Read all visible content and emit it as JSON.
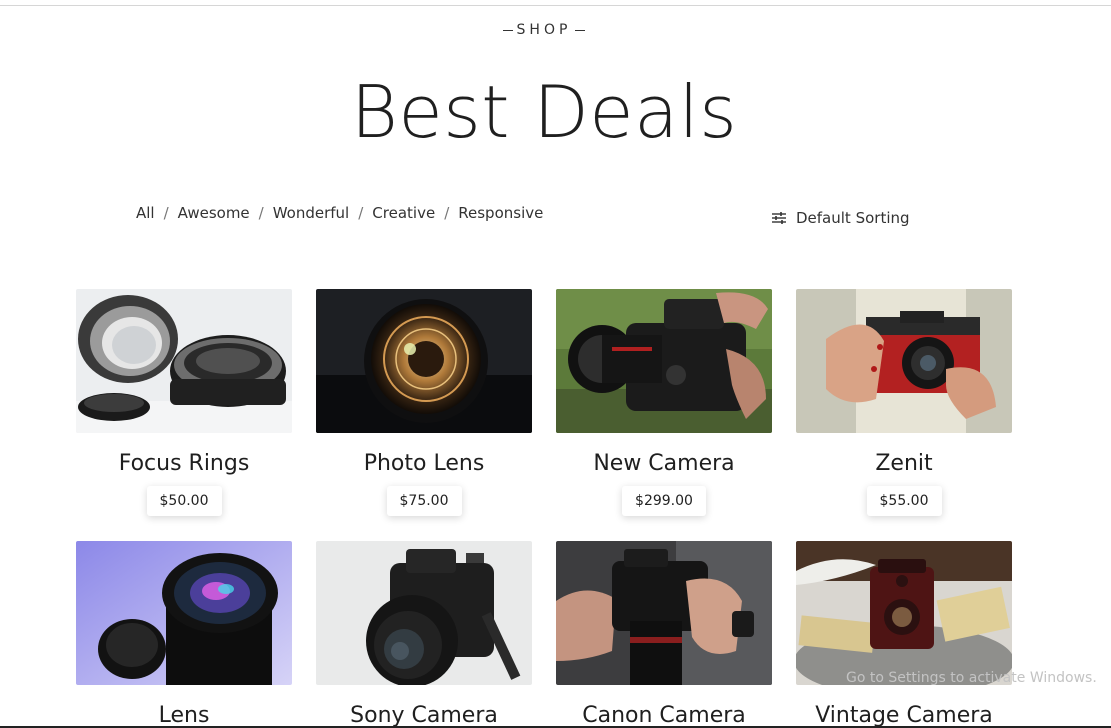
{
  "header": {
    "kicker": "SHOP",
    "title": "Best Deals"
  },
  "filters": [
    {
      "label": "All"
    },
    {
      "label": "Awesome"
    },
    {
      "label": "Wonderful"
    },
    {
      "label": "Creative"
    },
    {
      "label": "Responsive"
    }
  ],
  "filter_separator": "/",
  "sorting": {
    "label": "Default Sorting",
    "icon": "sliders-icon"
  },
  "products": [
    {
      "name": "Focus Rings",
      "price": "$50.00"
    },
    {
      "name": "Photo Lens",
      "price": "$75.00"
    },
    {
      "name": "New Camera",
      "price": "$299.00"
    },
    {
      "name": "Zenit",
      "price": "$55.00"
    },
    {
      "name": "Lens",
      "price": ""
    },
    {
      "name": "Sony Camera",
      "price": ""
    },
    {
      "name": "Canon Camera",
      "price": ""
    },
    {
      "name": "Vintage Camera",
      "price": ""
    }
  ],
  "overlay": {
    "windows_watermark": "Go to Settings to activate Windows."
  },
  "colors": {
    "text": "#212529",
    "background": "#ffffff"
  }
}
